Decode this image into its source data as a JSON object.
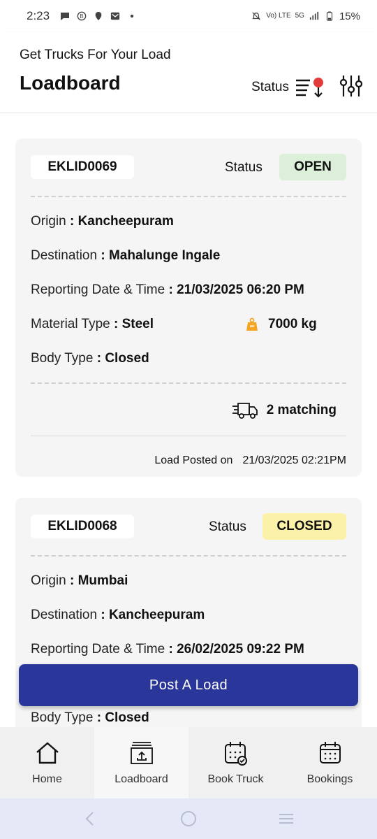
{
  "status_bar": {
    "time": "2:23",
    "battery": "15%",
    "network": "5G",
    "volte": "Vo) LTE"
  },
  "header": {
    "subtitle": "Get Trucks For Your Load",
    "title": "Loadboard",
    "status_filter_label": "Status"
  },
  "loads": [
    {
      "id": "EKLID0069",
      "status_label": "Status",
      "status": "OPEN",
      "origin_label": "Origin",
      "origin": "Kancheepuram",
      "destination_label": "Destination",
      "destination": "Mahalunge Ingale",
      "reporting_label": "Reporting Date & Time",
      "reporting": "21/03/2025 06:20 PM",
      "material_label": "Material Type",
      "material": "Steel",
      "weight": "7000 kg",
      "body_label": "Body Type",
      "body": "Closed",
      "matching": "2  matching",
      "posted_label": "Load Posted on",
      "posted": "21/03/2025 02:21PM"
    },
    {
      "id": "EKLID0068",
      "status_label": "Status",
      "status": "CLOSED",
      "origin_label": "Origin",
      "origin": "Mumbai",
      "destination_label": "Destination",
      "destination": "Kancheepuram",
      "reporting_label": "Reporting Date & Time",
      "reporting": "26/02/2025 09:22 PM",
      "body_label": "Body Type",
      "body": "Closed"
    }
  ],
  "post_button": "Post A Load",
  "bottom_nav": [
    {
      "label": "Home",
      "icon": "home-icon"
    },
    {
      "label": "Loadboard",
      "icon": "loadboard-icon",
      "active": true
    },
    {
      "label": "Book Truck",
      "icon": "book-truck-icon"
    },
    {
      "label": "Bookings",
      "icon": "bookings-icon"
    }
  ],
  "colors": {
    "primary": "#2a369a",
    "open_badge": "#dcefd8",
    "closed_badge": "#fbf1a9",
    "weight_icon": "#f5a524",
    "status_dot": "#e23b3b"
  }
}
